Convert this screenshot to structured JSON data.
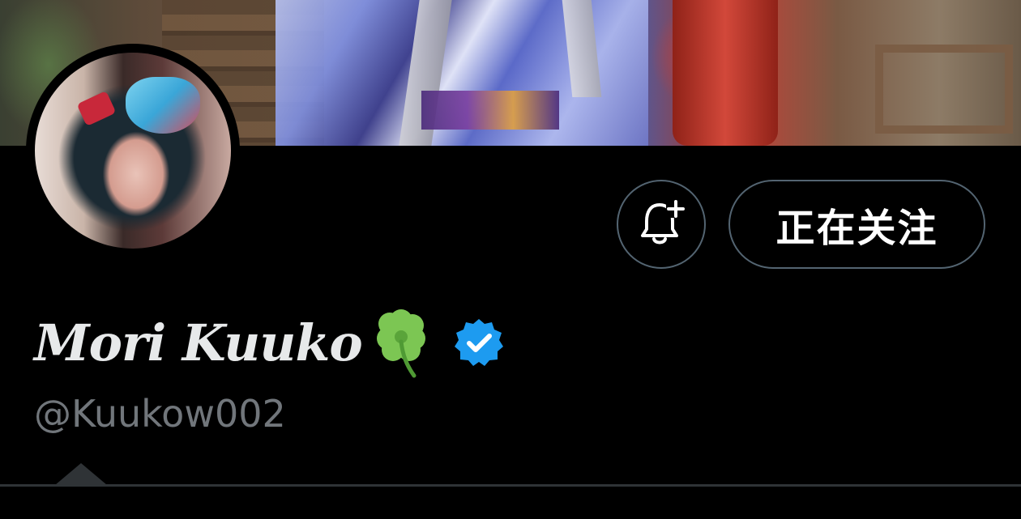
{
  "profile": {
    "display_name": "Mori Kuuko",
    "handle": "@Kuukow002",
    "verified": true
  },
  "actions": {
    "notify_icon": "bell-plus-icon",
    "follow_label": "正在关注"
  },
  "icons": {
    "name_emoji": "four-leaf-clover-icon",
    "badge": "verified-badge-icon"
  },
  "colors": {
    "background": "#000000",
    "button_border": "#536471",
    "name_text": "#e7e9ea",
    "handle_text": "#71767b",
    "verified_blue": "#1d9bf0",
    "clover_green": "#6fc24a",
    "divider": "#2f3336"
  }
}
